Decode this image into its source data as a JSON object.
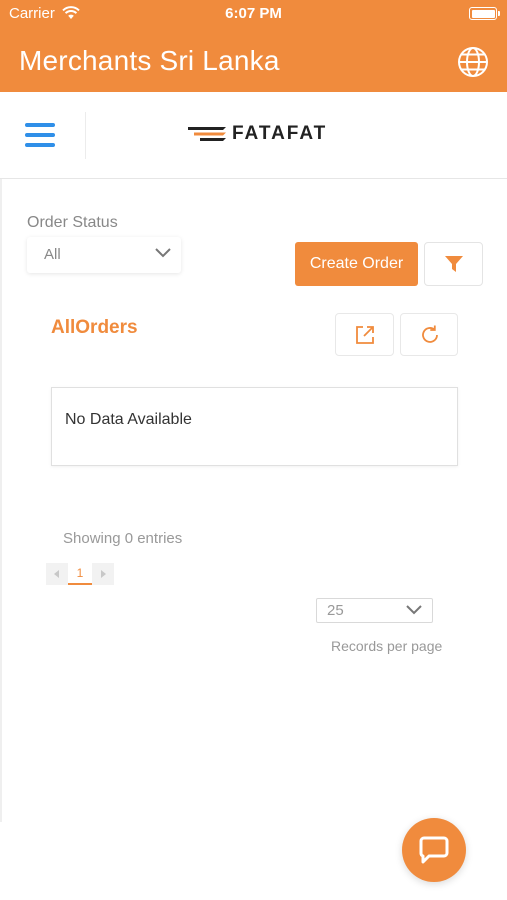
{
  "status_bar": {
    "carrier": "Carrier",
    "time": "6:07 PM"
  },
  "header": {
    "title": "Merchants Sri Lanka",
    "language_icon": "globe-icon"
  },
  "navbar": {
    "menu_icon": "hamburger-menu-icon",
    "logo_text": "FATAFAT"
  },
  "filters": {
    "order_status_label": "Order Status",
    "order_status_value": "All",
    "create_order_label": "Create Order",
    "filter_icon": "funnel-icon"
  },
  "orders": {
    "title": "AllOrders",
    "export_icon": "external-link-icon",
    "refresh_icon": "refresh-icon",
    "empty_message": "No Data Available"
  },
  "pagination": {
    "showing_text": "Showing 0 entries",
    "current_page": "1",
    "per_page_value": "25",
    "records_per_page_label": "Records per page"
  },
  "chat": {
    "icon": "chat-bubble-icon"
  },
  "colors": {
    "brand_orange": "#f08b3d",
    "menu_blue": "#2f8fe8"
  }
}
